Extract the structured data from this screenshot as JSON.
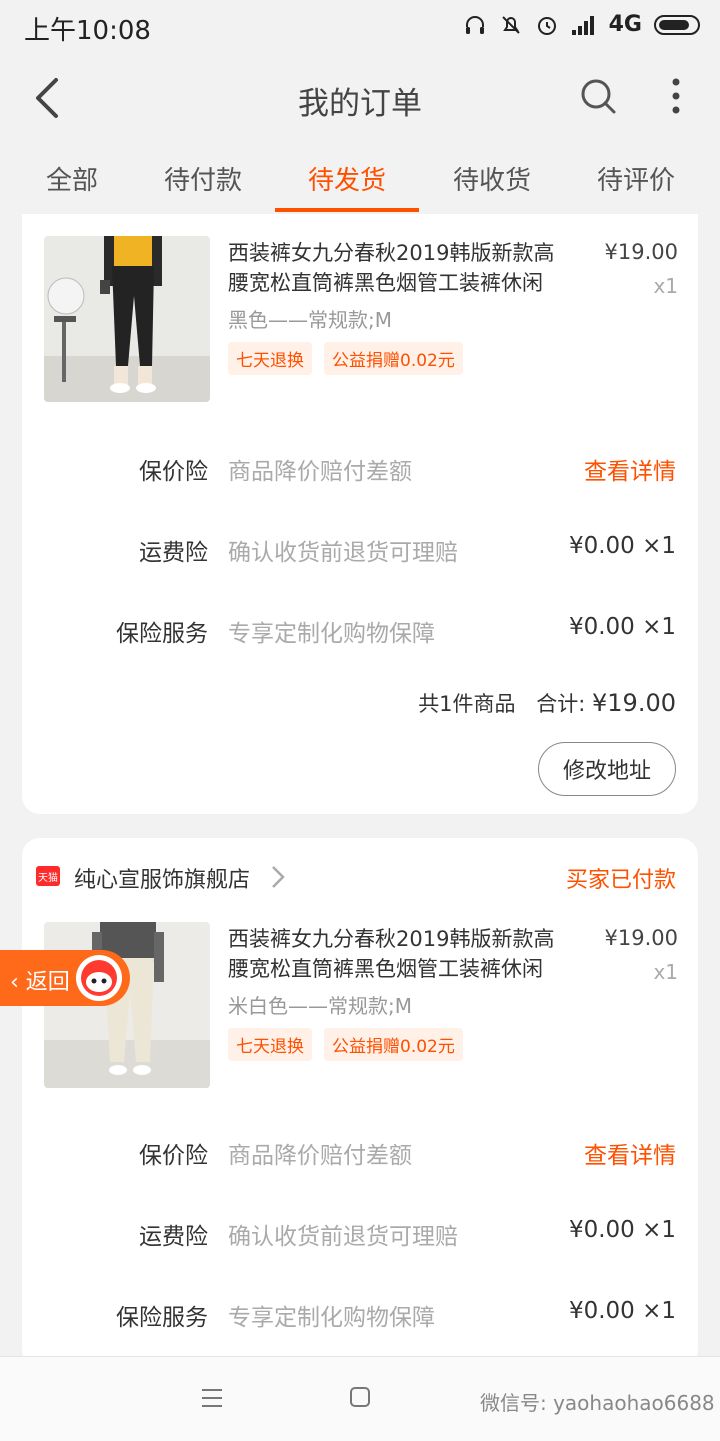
{
  "status_bar": {
    "time": "上午10:08",
    "network": "4G"
  },
  "nav": {
    "title": "我的订单"
  },
  "tabs": [
    {
      "label": "全部"
    },
    {
      "label": "待付款"
    },
    {
      "label": "待发货",
      "active": true
    },
    {
      "label": "待收货"
    },
    {
      "label": "待评价"
    }
  ],
  "orders": [
    {
      "product": {
        "title": "西装裤女九分春秋2019韩版新款高腰宽松直筒裤黑色烟管工装裤休闲",
        "variant": "黑色——常规款;M",
        "price": "¥19.00",
        "qty": "x1",
        "tags": [
          "七天退换",
          "公益捐赠0.02元"
        ]
      },
      "insurance": [
        {
          "label": "保价险",
          "desc": "商品降价赔付差额",
          "right": "查看详情",
          "link": true
        },
        {
          "label": "运费险",
          "desc": "确认收货前退货可理赔",
          "right": "¥0.00 ×1"
        },
        {
          "label": "保险服务",
          "desc": "专享定制化购物保障",
          "right": "¥0.00 ×1"
        }
      ],
      "summary": {
        "count": "共1件商品",
        "total_label": "合计: ",
        "total": "¥19.00"
      },
      "button": "修改地址"
    },
    {
      "shop": {
        "logo": "天猫",
        "name": "纯心宣服饰旗舰店",
        "status": "买家已付款"
      },
      "product": {
        "title": "西装裤女九分春秋2019韩版新款高腰宽松直筒裤黑色烟管工装裤休闲",
        "variant": "米白色——常规款;M",
        "price": "¥19.00",
        "qty": "x1",
        "tags": [
          "七天退换",
          "公益捐赠0.02元"
        ]
      },
      "insurance": [
        {
          "label": "保价险",
          "desc": "商品降价赔付差额",
          "right": "查看详情",
          "link": true
        },
        {
          "label": "运费险",
          "desc": "确认收货前退货可理赔",
          "right": "¥0.00 ×1"
        },
        {
          "label": "保险服务",
          "desc": "专享定制化购物保障",
          "right": "¥0.00 ×1"
        }
      ]
    }
  ],
  "float_back": {
    "label": "返回"
  },
  "watermark": "微信号: yaohaohao6688"
}
